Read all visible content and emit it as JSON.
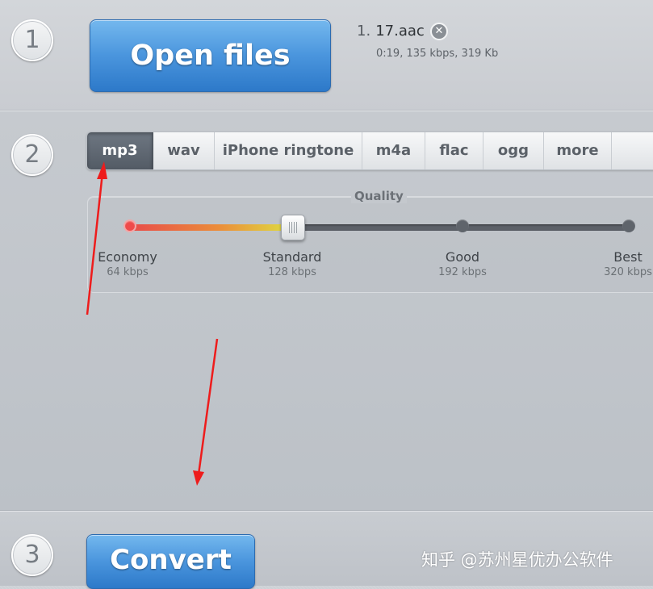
{
  "step1": {
    "number": "1",
    "open_label": "Open files",
    "file": {
      "index": "1.",
      "name": "17.aac",
      "meta": "0:19, 135 kbps, 319 Kb",
      "remove_icon": "close-circle-icon"
    }
  },
  "step2": {
    "number": "2",
    "tabs": [
      {
        "label": "mp3",
        "active": true
      },
      {
        "label": "wav"
      },
      {
        "label": "iPhone ringtone"
      },
      {
        "label": "m4a"
      },
      {
        "label": "flac"
      },
      {
        "label": "ogg"
      },
      {
        "label": "more"
      }
    ],
    "quality": {
      "title": "Quality",
      "selected": "Standard",
      "levels": [
        {
          "name": "Economy",
          "rate": "64 kbps"
        },
        {
          "name": "Standard",
          "rate": "128 kbps"
        },
        {
          "name": "Good",
          "rate": "192 kbps"
        },
        {
          "name": "Best",
          "rate": "320 kbps"
        }
      ]
    }
  },
  "step3": {
    "number": "3",
    "convert_label": "Convert"
  },
  "watermark": "知乎 @苏州星优办公软件",
  "colors": {
    "accent_blue": "#4a95dd",
    "annotation_red": "#ee1c1c"
  }
}
